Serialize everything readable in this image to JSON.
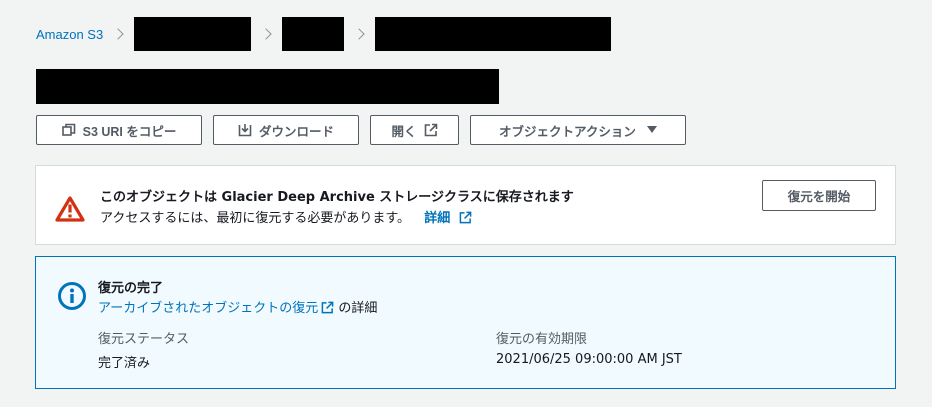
{
  "breadcrumb": {
    "root": "Amazon S3"
  },
  "toolbar": {
    "copy_uri": "S3 URI をコピー",
    "download": "ダウンロード",
    "open": "開く",
    "object_actions": "オブジェクトアクション"
  },
  "warning": {
    "title": "このオブジェクトは Glacier Deep Archive ストレージクラスに保存されます",
    "body": "アクセスするには、最初に復元する必要があります。",
    "more_link": "詳細",
    "restore_button": "復元を開始"
  },
  "info": {
    "title": "復元の完了",
    "link": "アーカイブされたオブジェクトの復元",
    "link_suffix": "の詳細",
    "status_label": "復元ステータス",
    "status_value": "完了済み",
    "expiry_label": "復元の有効期限",
    "expiry_value": "2021/06/25 09:00:00 AM JST"
  },
  "colors": {
    "link": "#0073bb",
    "warning": "#d13212",
    "info": "#0073bb",
    "background": "#f2f3f3"
  },
  "icons": {
    "breadcrumb_separator": "chevron-right-icon",
    "copy": "copy-icon",
    "download": "download-icon",
    "external": "external-link-icon",
    "dropdown": "caret-down-icon",
    "warning": "warning-icon",
    "info": "info-icon"
  }
}
